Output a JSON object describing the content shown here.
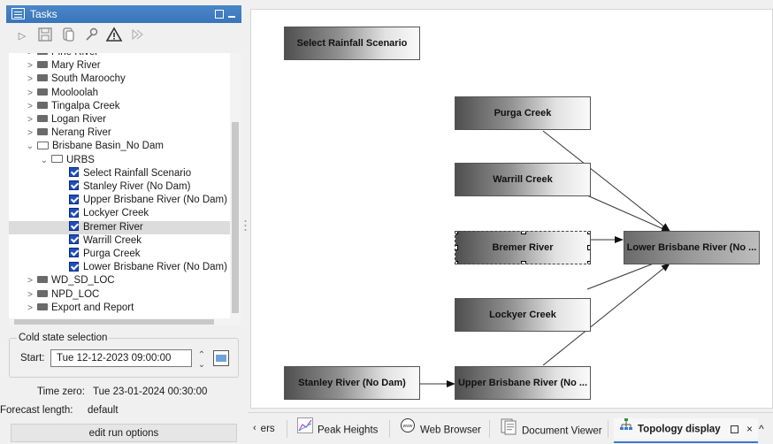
{
  "tasks_panel": {
    "title": "Tasks",
    "tree": [
      {
        "label": "Pine River",
        "level": 1,
        "type": "folder"
      },
      {
        "label": "Mary River",
        "level": 1,
        "type": "folder"
      },
      {
        "label": "South Maroochy",
        "level": 1,
        "type": "folder"
      },
      {
        "label": "Mooloolah",
        "level": 1,
        "type": "folder"
      },
      {
        "label": "Tingalpa Creek",
        "level": 1,
        "type": "folder"
      },
      {
        "label": "Logan River",
        "level": 1,
        "type": "folder"
      },
      {
        "label": "Nerang River",
        "level": 1,
        "type": "folder"
      },
      {
        "label": "Brisbane Basin_No Dam",
        "level": 1,
        "type": "folder-open"
      },
      {
        "label": "URBS",
        "level": 2,
        "type": "folder-open"
      },
      {
        "label": "Select Rainfall Scenario",
        "level": 3,
        "type": "check"
      },
      {
        "label": "Stanley River (No Dam)",
        "level": 3,
        "type": "check"
      },
      {
        "label": "Upper Brisbane River (No Dam)",
        "level": 3,
        "type": "check"
      },
      {
        "label": "Lockyer Creek",
        "level": 3,
        "type": "check"
      },
      {
        "label": "Bremer River",
        "level": 3,
        "type": "check",
        "selected": true
      },
      {
        "label": "Warrill Creek",
        "level": 3,
        "type": "check"
      },
      {
        "label": "Purga Creek",
        "level": 3,
        "type": "check"
      },
      {
        "label": "Lower Brisbane River (No Dam)",
        "level": 3,
        "type": "check"
      },
      {
        "label": "WD_SD_LOC",
        "level": 1,
        "type": "folder"
      },
      {
        "label": "NPD_LOC",
        "level": 1,
        "type": "folder"
      },
      {
        "label": "Export and Report",
        "level": 1,
        "type": "folder"
      }
    ],
    "cold_state": {
      "legend": "Cold state selection",
      "start_label": "Start:",
      "start_value": "Tue 12-12-2023 09:00:00"
    },
    "time_zero_label": "Time zero:",
    "time_zero_value": "Tue 23-01-2024 00:30:00",
    "forecast_label": "Forecast length:",
    "forecast_value": "default",
    "edit_run_label": "edit run options"
  },
  "topology": {
    "nodes": {
      "select_rainfall": "Select Rainfall Scenario",
      "purga": "Purga Creek",
      "warrill": "Warrill Creek",
      "bremer": "Bremer River",
      "lower_brisbane": "Lower Brisbane River (No ...",
      "lockyer": "Lockyer Creek",
      "stanley": "Stanley River (No Dam)",
      "upper_brisbane": "Upper Brisbane River (No ..."
    }
  },
  "tabs": {
    "partial": "ers",
    "peak_heights": "Peak Heights",
    "web_browser": "Web Browser",
    "document_viewer": "Document Viewer",
    "topology_display": "Topology display"
  },
  "colors": {
    "title_bar": "#3975b9",
    "checkbox": "#1d4fbf",
    "tab_underline": "#3a7bd5"
  }
}
